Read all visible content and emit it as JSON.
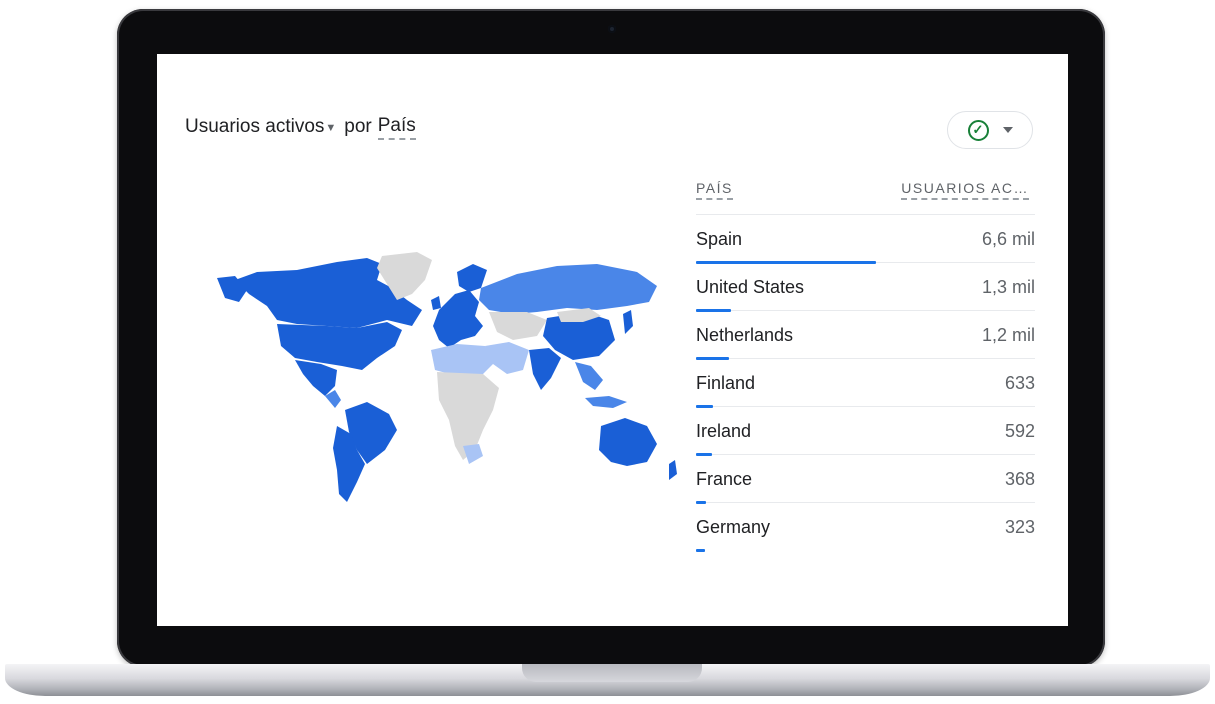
{
  "card": {
    "metric_label": "Usuarios activos",
    "by_label": "por",
    "dimension_label": "País"
  },
  "compare_button": {
    "icon": "check-circle-icon",
    "status_color": "#188038"
  },
  "table": {
    "header_country": "PAÍS",
    "header_users": "USUARIOS AC…",
    "bar_color": "#1a73e8",
    "rows": [
      {
        "country": "Spain",
        "value": "6,6 mil",
        "share": 1.0
      },
      {
        "country": "United States",
        "value": "1,3 mil",
        "share": 0.197
      },
      {
        "country": "Netherlands",
        "value": "1,2 mil",
        "share": 0.182
      },
      {
        "country": "Finland",
        "value": "633",
        "share": 0.096
      },
      {
        "country": "Ireland",
        "value": "592",
        "share": 0.09
      },
      {
        "country": "France",
        "value": "368",
        "share": 0.056
      },
      {
        "country": "Germany",
        "value": "323",
        "share": 0.049
      }
    ]
  },
  "map": {
    "colors": {
      "high": "#1a5fd6",
      "mid": "#4a86e8",
      "low": "#a9c4f5",
      "none": "#d9d9d9"
    }
  }
}
